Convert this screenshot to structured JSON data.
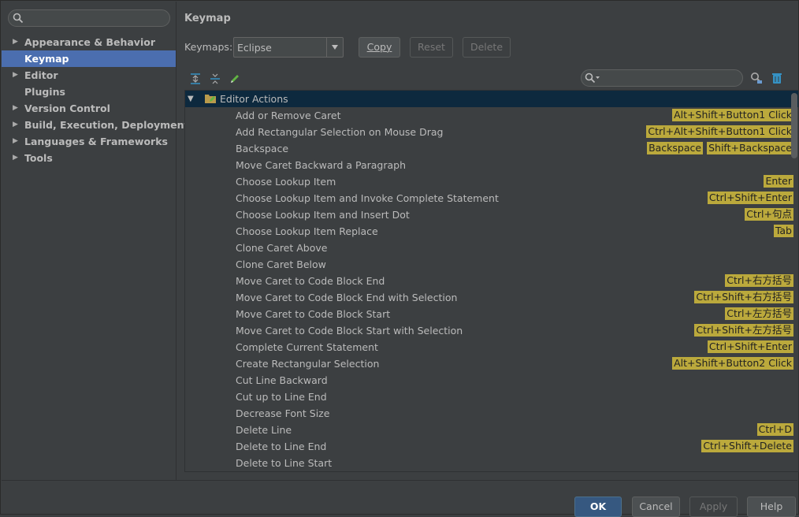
{
  "sidebar": {
    "items": [
      {
        "label": "Appearance & Behavior",
        "expandable": true,
        "active": false
      },
      {
        "label": "Keymap",
        "expandable": false,
        "active": true
      },
      {
        "label": "Editor",
        "expandable": true,
        "active": false
      },
      {
        "label": "Plugins",
        "expandable": false,
        "active": false
      },
      {
        "label": "Version Control",
        "expandable": true,
        "active": false
      },
      {
        "label": "Build, Execution, Deployment",
        "expandable": true,
        "active": false
      },
      {
        "label": "Languages & Frameworks",
        "expandable": true,
        "active": false
      },
      {
        "label": "Tools",
        "expandable": true,
        "active": false
      }
    ]
  },
  "main": {
    "title": "Keymap",
    "keymaps_label": "Keymaps:",
    "keymap_value": "Eclipse",
    "copy_label": "Copy",
    "reset_label": "Reset",
    "delete_label": "Delete"
  },
  "tree": {
    "group": "Editor Actions",
    "rows": [
      {
        "label": "Add or Remove Caret",
        "shortcuts": [
          "Alt+Shift+Button1 Click"
        ]
      },
      {
        "label": "Add Rectangular Selection on Mouse Drag",
        "shortcuts": [
          "Ctrl+Alt+Shift+Button1 Click"
        ]
      },
      {
        "label": "Backspace",
        "shortcuts": [
          "Backspace",
          "Shift+Backspace"
        ]
      },
      {
        "label": "Move Caret Backward a Paragraph",
        "shortcuts": []
      },
      {
        "label": "Choose Lookup Item",
        "shortcuts": [
          "Enter"
        ]
      },
      {
        "label": "Choose Lookup Item and Invoke Complete Statement",
        "shortcuts": [
          "Ctrl+Shift+Enter"
        ]
      },
      {
        "label": "Choose Lookup Item and Insert Dot",
        "shortcuts": [
          "Ctrl+句点"
        ]
      },
      {
        "label": "Choose Lookup Item Replace",
        "shortcuts": [
          "Tab"
        ]
      },
      {
        "label": "Clone Caret Above",
        "shortcuts": []
      },
      {
        "label": "Clone Caret Below",
        "shortcuts": []
      },
      {
        "label": "Move Caret to Code Block End",
        "shortcuts": [
          "Ctrl+右方括号"
        ]
      },
      {
        "label": "Move Caret to Code Block End with Selection",
        "shortcuts": [
          "Ctrl+Shift+右方括号"
        ]
      },
      {
        "label": "Move Caret to Code Block Start",
        "shortcuts": [
          "Ctrl+左方括号"
        ]
      },
      {
        "label": "Move Caret to Code Block Start with Selection",
        "shortcuts": [
          "Ctrl+Shift+左方括号"
        ]
      },
      {
        "label": "Complete Current Statement",
        "shortcuts": [
          "Ctrl+Shift+Enter"
        ]
      },
      {
        "label": "Create Rectangular Selection",
        "shortcuts": [
          "Alt+Shift+Button2 Click"
        ]
      },
      {
        "label": "Cut Line Backward",
        "shortcuts": []
      },
      {
        "label": "Cut up to Line End",
        "shortcuts": []
      },
      {
        "label": "Decrease Font Size",
        "shortcuts": []
      },
      {
        "label": "Delete Line",
        "shortcuts": [
          "Ctrl+D"
        ]
      },
      {
        "label": "Delete to Line End",
        "shortcuts": [
          "Ctrl+Shift+Delete"
        ]
      },
      {
        "label": "Delete to Line Start",
        "shortcuts": []
      }
    ]
  },
  "footer": {
    "ok_label": "OK",
    "cancel_label": "Cancel",
    "apply_label": "Apply",
    "help_label": "Help"
  },
  "colors": {
    "background": "#3c3f41",
    "selection": "#4b6eaf",
    "tree_header": "#0d293e",
    "shortcut_badge": "#bba93c"
  }
}
